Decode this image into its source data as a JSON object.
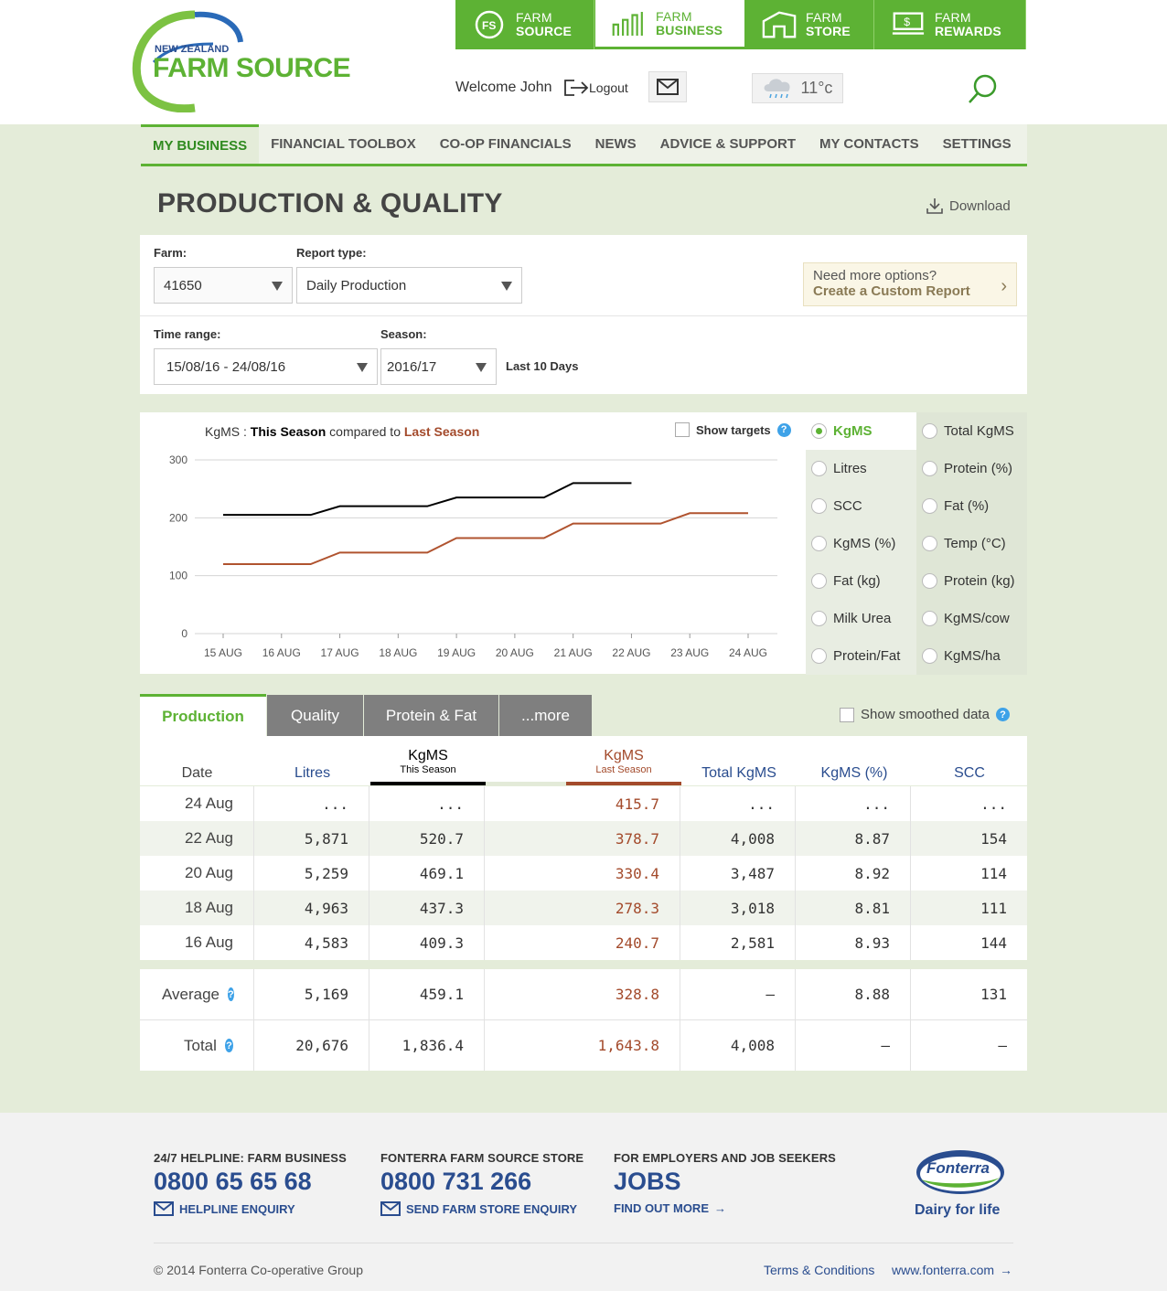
{
  "header": {
    "logo_line1": "NEW ZEALAND",
    "logo_line2": "FARM SOURCE",
    "tabs": [
      {
        "line1": "FARM",
        "line2": "SOURCE",
        "icon": "farm-source-icon"
      },
      {
        "line1": "FARM",
        "line2": "BUSINESS",
        "icon": "bar-chart-icon"
      },
      {
        "line1": "FARM",
        "line2": "STORE",
        "icon": "store-icon"
      },
      {
        "line1": "FARM",
        "line2": "REWARDS",
        "icon": "rewards-icon"
      }
    ],
    "welcome": "Welcome John",
    "logout": "Logout",
    "temperature": "11°c"
  },
  "nav": [
    "MY BUSINESS",
    "FINANCIAL TOOLBOX",
    "CO-OP FINANCIALS",
    "NEWS",
    "ADVICE & SUPPORT",
    "MY CONTACTS",
    "SETTINGS"
  ],
  "page": {
    "title": "PRODUCTION & QUALITY",
    "download": "Download"
  },
  "filters": {
    "farm_label": "Farm:",
    "farm_value": "41650",
    "report_label": "Report type:",
    "report_value": "Daily Production",
    "time_label": "Time range:",
    "time_value": "15/08/16 - 24/08/16",
    "season_label": "Season:",
    "season_value": "2016/17",
    "range_note": "Last 10 Days",
    "custom_line1": "Need more options?",
    "custom_line2": "Create a Custom Report"
  },
  "chart_header": {
    "metric": "KgMS",
    "sep": " : ",
    "this": "This Season",
    "compared": " compared to ",
    "last": "Last Season",
    "show_targets": "Show targets"
  },
  "chart_data": {
    "type": "line",
    "categories": [
      "15 AUG",
      "16 AUG",
      "17 AUG",
      "18 AUG",
      "19 AUG",
      "20 AUG",
      "21 AUG",
      "22 AUG",
      "23 AUG",
      "24 AUG"
    ],
    "ylim": [
      0,
      300
    ],
    "yticks": [
      0,
      100,
      200,
      300
    ],
    "series": [
      {
        "name": "This Season",
        "color": "#000000",
        "values": [
          205,
          205,
          220,
          220,
          235,
          235,
          260,
          260,
          null,
          null
        ]
      },
      {
        "name": "Last Season",
        "color": "#b0532f",
        "values": [
          120,
          120,
          140,
          140,
          165,
          165,
          190,
          190,
          208,
          208
        ]
      }
    ],
    "grid": true
  },
  "metrics": [
    "KgMS",
    "Total KgMS",
    "Litres",
    "Protein (%)",
    "SCC",
    "Fat (%)",
    "KgMS (%)",
    "Temp (°C)",
    "Fat (kg)",
    "Protein (kg)",
    "Milk Urea",
    "KgMS/cow",
    "Protein/Fat",
    "KgMS/ha"
  ],
  "tabs": [
    "Production",
    "Quality",
    "Protein & Fat",
    "...more"
  ],
  "smoothed": "Show smoothed data",
  "table": {
    "headers": {
      "date": "Date",
      "litres": "Litres",
      "kgms": "KgMS",
      "this_season": "This Season",
      "kgms2": "KgMS",
      "last_season": "Last Season",
      "total": "Total KgMS",
      "pct": "KgMS (%)",
      "scc": "SCC"
    },
    "rows": [
      [
        "24  Aug",
        "...",
        "...",
        "415.7",
        "...",
        "...",
        "..."
      ],
      [
        "22  Aug",
        "5,871",
        "520.7",
        "378.7",
        "4,008",
        "8.87",
        "154"
      ],
      [
        "20  Aug",
        "5,259",
        "469.1",
        "330.4",
        "3,487",
        "8.92",
        "114"
      ],
      [
        "18  Aug",
        "4,963",
        "437.3",
        "278.3",
        "3,018",
        "8.81",
        "111"
      ],
      [
        "16  Aug",
        "4,583",
        "409.3",
        "240.7",
        "2,581",
        "8.93",
        "144"
      ]
    ],
    "average": [
      "Average",
      "5,169",
      "459.1",
      "328.8",
      "–",
      "8.88",
      "131"
    ],
    "total": [
      "Total",
      "20,676",
      "1,836.4",
      "1,643.8",
      "4,008",
      "–",
      "–"
    ]
  },
  "footer": {
    "col1_head": "24/7 HELPLINE: FARM BUSINESS",
    "col1_big": "0800 65 65 68",
    "col1_link": "HELPLINE ENQUIRY",
    "col2_head": "FONTERRA FARM SOURCE STORE",
    "col2_big": "0800 731 266",
    "col2_link": "SEND FARM STORE ENQUIRY",
    "col3_head": "FOR EMPLOYERS AND JOB SEEKERS",
    "col3_big": "JOBS",
    "col3_link": "FIND OUT MORE",
    "brand": "Fonterra",
    "tagline": "Dairy for life",
    "copyright": "© 2014 Fonterra Co-operative Group",
    "terms": "Terms & Conditions",
    "site": "www.fonterra.com"
  },
  "colors": {
    "brand_green": "#5db234",
    "last_season": "#a34a2b",
    "link_blue": "#2a4d8f"
  }
}
